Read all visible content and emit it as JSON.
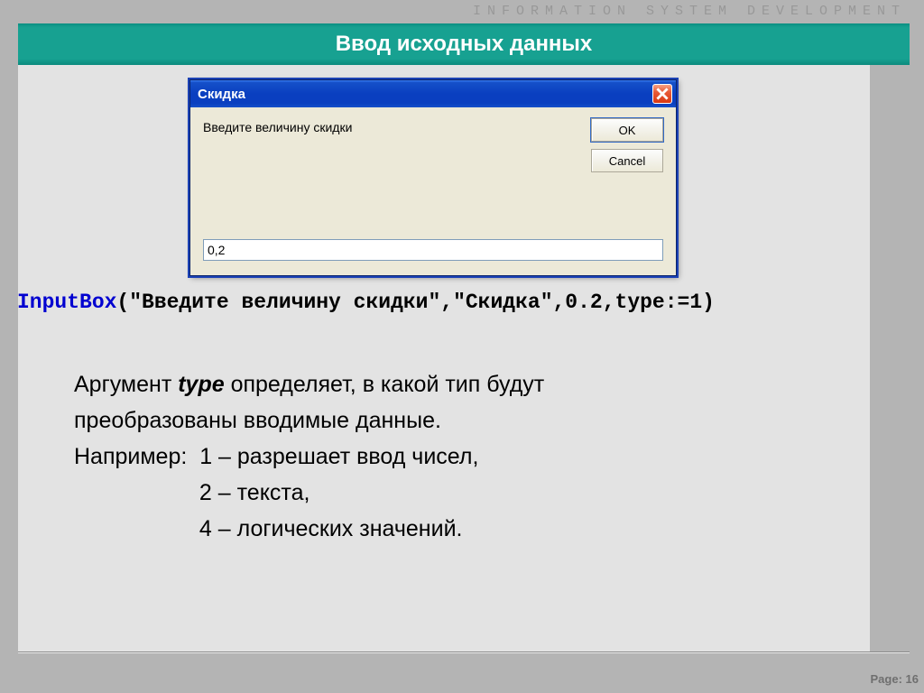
{
  "tagline": "INFORMATION  SYSTEM   DEVELOPMENT",
  "slide_title": "Ввод исходных данных",
  "dialog": {
    "title": "Скидка",
    "prompt": "Введите величину скидки",
    "ok": "OK",
    "cancel": "Cancel",
    "input_value": "0,2"
  },
  "code": {
    "fn": "InputBox",
    "rest": "(\"Введите величину скидки\",\"Скидка\",0.2,type:=1)"
  },
  "paragraph": {
    "arg_word_pre": "Аргумент ",
    "arg_name": "type",
    "arg_word_post": "  определяет, в какой тип будут",
    "line2": "преобразованы вводимые данные.",
    "ex_label": "Например:  1 – разрешает ввод чисел,",
    "ex2": "                    2 – текста,",
    "ex3": "                    4 – логических значений."
  },
  "page": {
    "label": "Page: 16"
  }
}
